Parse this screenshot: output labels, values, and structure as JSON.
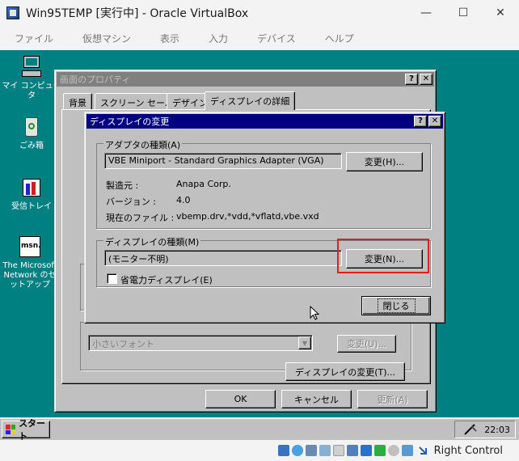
{
  "host": {
    "title": "Win95TEMP [実行中] - Oracle VirtualBox",
    "menu": [
      "ファイル",
      "仮想マシン",
      "表示",
      "入力",
      "デバイス",
      "ヘルプ"
    ],
    "status_text": "Right Control"
  },
  "desktop": {
    "icons": [
      {
        "label": "マイ コンピュータ"
      },
      {
        "label": "ごみ箱"
      },
      {
        "label": "受信トレイ"
      },
      {
        "label": "The Microsoft Network のセットアップ"
      }
    ]
  },
  "props": {
    "title": "画面のプロパティ",
    "tabs": [
      "背景",
      "スクリーン セーバー",
      "デザイン",
      "ディスプレイの詳細"
    ],
    "font_combo": "小さいフォント",
    "change_font_btn": "変更(U)...",
    "change_display_btn": "ディスプレイの変更(T)...",
    "ok": "OK",
    "cancel": "キャンセル",
    "apply": "更新(A)"
  },
  "dialog": {
    "title": "ディスプレイの変更",
    "adapter_group": "アダプタの種類(A)",
    "adapter_value": "VBE Miniport - Standard Graphics Adapter (VGA)",
    "adapter_change_btn": "変更(H)...",
    "info": [
      {
        "label": "製造元 :",
        "value": "Anapa Corp."
      },
      {
        "label": "バージョン :",
        "value": "4.0"
      },
      {
        "label": "現在のファイル :",
        "value": "vbemp.drv,*vdd,*vflatd,vbe.vxd"
      }
    ],
    "monitor_group": "ディスプレイの種類(M)",
    "monitor_value": "(モニター不明)",
    "monitor_change_btn": "変更(N)...",
    "power_saving": "省電力ディスプレイ(E)",
    "close_btn": "閉じる"
  },
  "taskbar": {
    "start": "スタート",
    "clock": "22:03"
  },
  "colors": {
    "desktop": "#008080",
    "active_title": "#000080",
    "highlight": "#e02020"
  }
}
